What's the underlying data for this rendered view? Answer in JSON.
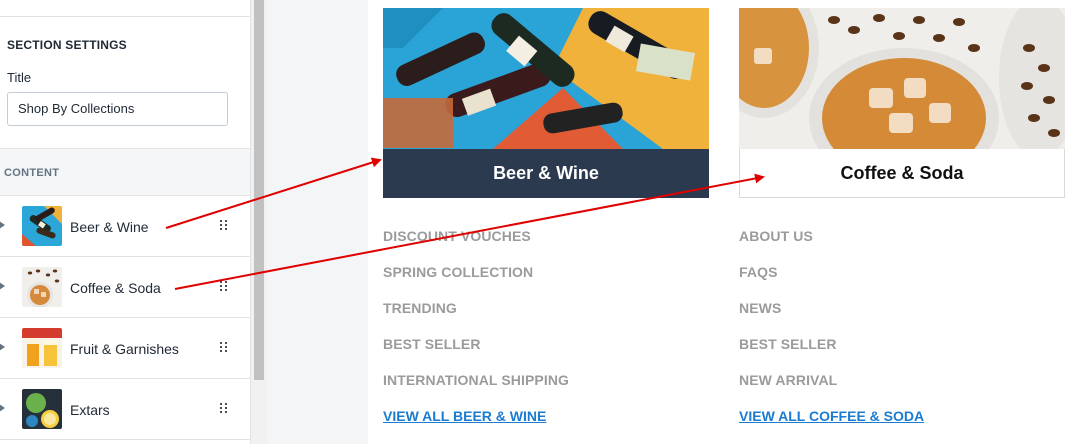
{
  "section_settings": {
    "heading": "SECTION SETTINGS",
    "title_label": "Title",
    "title_value": "Shop By Collections"
  },
  "content": {
    "heading": "CONTENT",
    "blocks": [
      {
        "label": "Beer & Wine",
        "thumb_icon": "beer-wine-thumbnail"
      },
      {
        "label": "Coffee & Soda",
        "thumb_icon": "coffee-soda-thumbnail"
      },
      {
        "label": "Fruit & Garnishes",
        "thumb_icon": "fruit-garnishes-thumbnail"
      },
      {
        "label": "Extars",
        "thumb_icon": "extras-thumbnail"
      }
    ]
  },
  "preview": {
    "collections": [
      {
        "caption": "Beer & Wine",
        "links": [
          "DISCOUNT VOUCHES",
          "SPRING COLLECTION",
          "TRENDING",
          "BEST SELLER",
          "INTERNATIONAL SHIPPING"
        ],
        "view_all": "VIEW ALL BEER & WINE"
      },
      {
        "caption": "Coffee & Soda",
        "links": [
          "ABOUT US",
          "FAQS",
          "NEWS",
          "BEST SELLER",
          "NEW ARRIVAL"
        ],
        "view_all": "VIEW ALL COFFEE & SODA"
      }
    ]
  },
  "colors": {
    "caption_dark_bg": "#2b3a4f",
    "link_gray": "#9b9b9b",
    "view_all_blue": "#1a7bd0",
    "annotation_arrow": "#e00000"
  }
}
